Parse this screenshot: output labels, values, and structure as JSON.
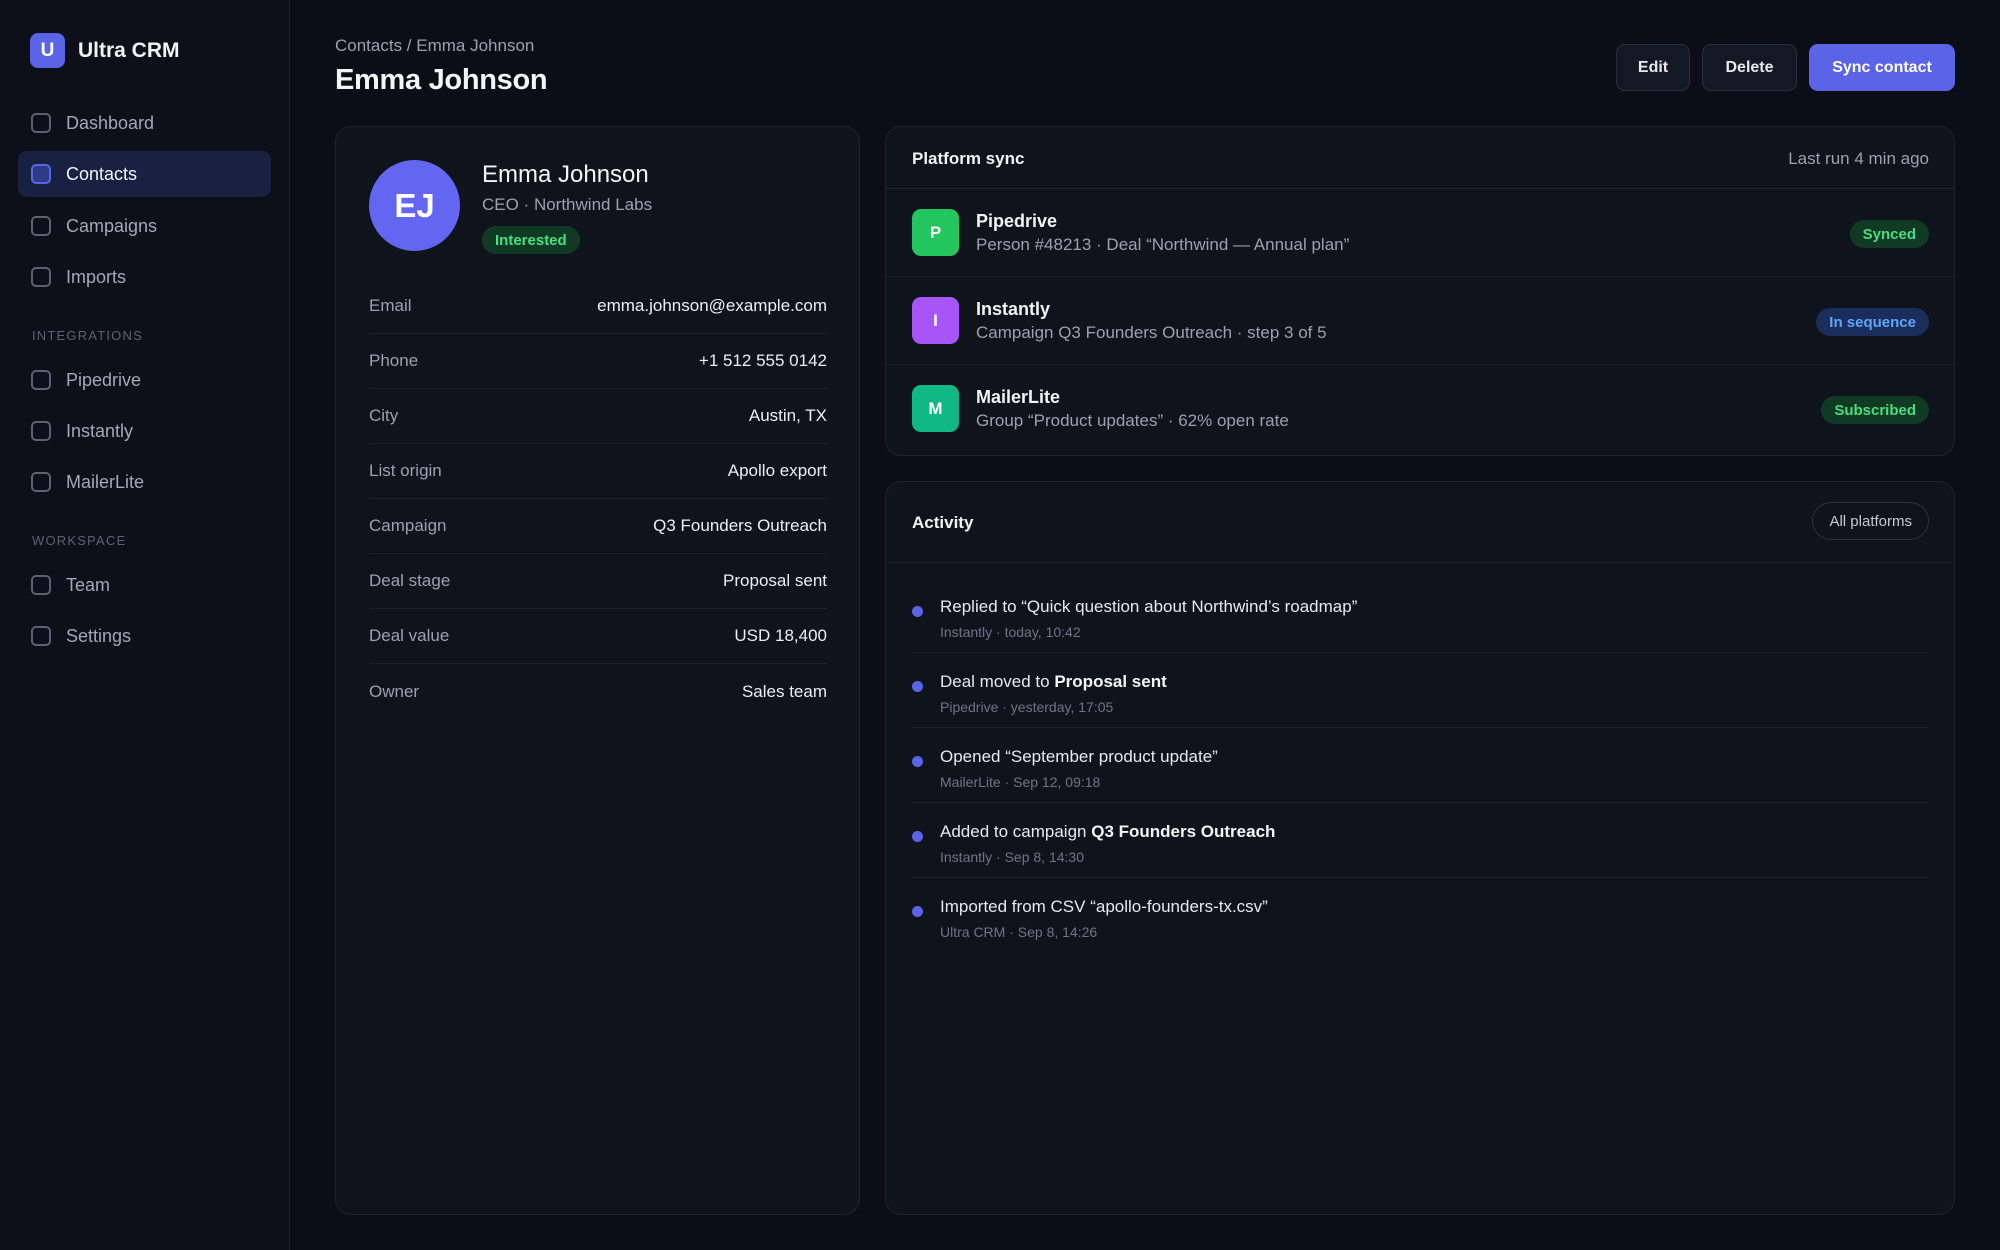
{
  "app": {
    "logo_letter": "U",
    "name": "Ultra CRM"
  },
  "sidebar": {
    "main_items": [
      {
        "label": "Dashboard"
      },
      {
        "label": "Contacts"
      },
      {
        "label": "Campaigns"
      },
      {
        "label": "Imports"
      }
    ],
    "integrations_heading": "INTEGRATIONS",
    "integration_items": [
      {
        "label": "Pipedrive"
      },
      {
        "label": "Instantly"
      },
      {
        "label": "MailerLite"
      }
    ],
    "workspace_heading": "WORKSPACE",
    "workspace_items": [
      {
        "label": "Team"
      },
      {
        "label": "Settings"
      }
    ]
  },
  "header": {
    "breadcrumb": "Contacts / Emma Johnson",
    "title": "Emma Johnson",
    "edit_label": "Edit",
    "delete_label": "Delete",
    "sync_label": "Sync contact"
  },
  "profile": {
    "initials": "EJ",
    "name": "Emma Johnson",
    "role": "CEO · Northwind Labs",
    "status": "Interested",
    "fields": [
      {
        "label": "Email",
        "value": "emma.johnson@example.com"
      },
      {
        "label": "Phone",
        "value": "+1 512 555 0142"
      },
      {
        "label": "City",
        "value": "Austin, TX"
      },
      {
        "label": "List origin",
        "value": "Apollo export"
      },
      {
        "label": "Campaign",
        "value": "Q3 Founders Outreach"
      },
      {
        "label": "Deal stage",
        "value": "Proposal sent"
      },
      {
        "label": "Deal value",
        "value": "USD 18,400"
      },
      {
        "label": "Owner",
        "value": "Sales team"
      }
    ]
  },
  "platform_sync": {
    "title": "Platform sync",
    "last_run": "Last run 4 min ago",
    "rows": [
      {
        "letter": "P",
        "name": "Pipedrive",
        "desc": "Person #48213 · Deal “Northwind — Annual plan”",
        "status": "Synced",
        "icon_color": "#22c55e"
      },
      {
        "letter": "I",
        "name": "Instantly",
        "desc": "Campaign Q3 Founders Outreach · step 3 of 5",
        "status": "In sequence",
        "icon_color": "#a855f7"
      },
      {
        "letter": "M",
        "name": "MailerLite",
        "desc": "Group “Product updates” · 62% open rate",
        "status": "Subscribed",
        "icon_color": "#10b981"
      }
    ]
  },
  "activity": {
    "title": "Activity",
    "filter_label": "All platforms",
    "items": [
      {
        "text": "Replied to “Quick question about Northwind’s roadmap”",
        "meta": "Instantly · today, 10:42"
      },
      {
        "text_pre": "Deal moved to ",
        "text_bold": "Proposal sent",
        "meta": "Pipedrive · yesterday, 17:05"
      },
      {
        "text": "Opened “September product update”",
        "meta": "MailerLite · Sep 12, 09:18"
      },
      {
        "text_pre": "Added to campaign ",
        "text_bold": "Q3 Founders Outreach",
        "meta": "Instantly · Sep 8, 14:30"
      },
      {
        "text": "Imported from CSV “apollo-founders-tx.csv”",
        "meta": "Ultra CRM · Sep 8, 14:26"
      }
    ]
  }
}
